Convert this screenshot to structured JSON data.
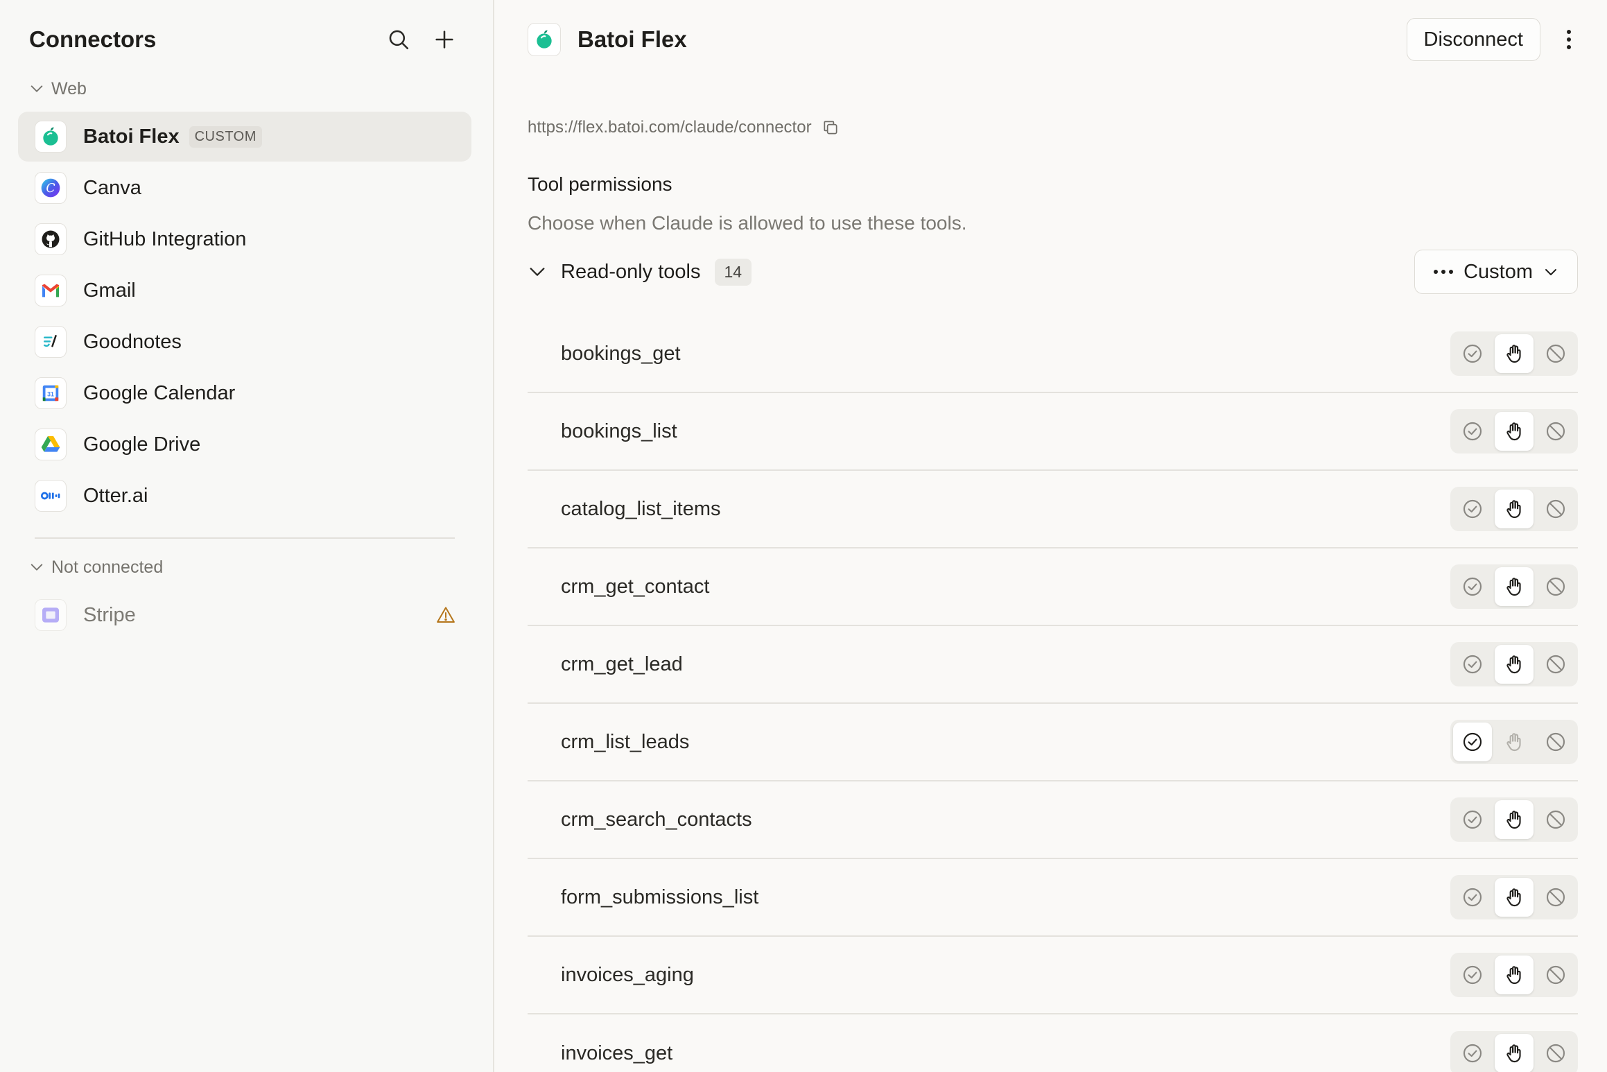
{
  "sidebar": {
    "title": "Connectors",
    "groups": {
      "web": {
        "label": "Web"
      },
      "not_connected": {
        "label": "Not connected"
      }
    },
    "items": [
      {
        "name": "Batoi Flex",
        "badge": "CUSTOM",
        "icon": "batoi-flex-logo-icon",
        "active": true
      },
      {
        "name": "Canva",
        "icon": "canva-logo-icon"
      },
      {
        "name": "GitHub Integration",
        "icon": "github-logo-icon"
      },
      {
        "name": "Gmail",
        "icon": "gmail-logo-icon"
      },
      {
        "name": "Goodnotes",
        "icon": "goodnotes-logo-icon"
      },
      {
        "name": "Google Calendar",
        "icon": "google-calendar-logo-icon"
      },
      {
        "name": "Google Drive",
        "icon": "google-drive-logo-icon"
      },
      {
        "name": "Otter.ai",
        "icon": "otter-logo-icon"
      }
    ],
    "not_connected_items": [
      {
        "name": "Stripe",
        "icon": "stripe-logo-icon",
        "status_icon": "warning-icon"
      }
    ]
  },
  "main": {
    "title": "Batoi Flex",
    "disconnect_label": "Disconnect",
    "url": "https://flex.batoi.com/claude/connector",
    "permissions_title": "Tool permissions",
    "permissions_subtitle": "Choose when Claude is allowed to use these tools.",
    "readonly_label": "Read-only tools",
    "readonly_count": "14",
    "custom_label": "Custom",
    "tools": [
      {
        "name": "bookings_get",
        "mode": "ask"
      },
      {
        "name": "bookings_list",
        "mode": "ask"
      },
      {
        "name": "catalog_list_items",
        "mode": "ask"
      },
      {
        "name": "crm_get_contact",
        "mode": "ask"
      },
      {
        "name": "crm_get_lead",
        "mode": "ask"
      },
      {
        "name": "crm_list_leads",
        "mode": "allow"
      },
      {
        "name": "crm_search_contacts",
        "mode": "ask"
      },
      {
        "name": "form_submissions_list",
        "mode": "ask"
      },
      {
        "name": "invoices_aging",
        "mode": "ask"
      },
      {
        "name": "invoices_get",
        "mode": "ask"
      }
    ]
  },
  "colors": {
    "accent_green": "#19b38a",
    "warning": "#b5761b"
  }
}
